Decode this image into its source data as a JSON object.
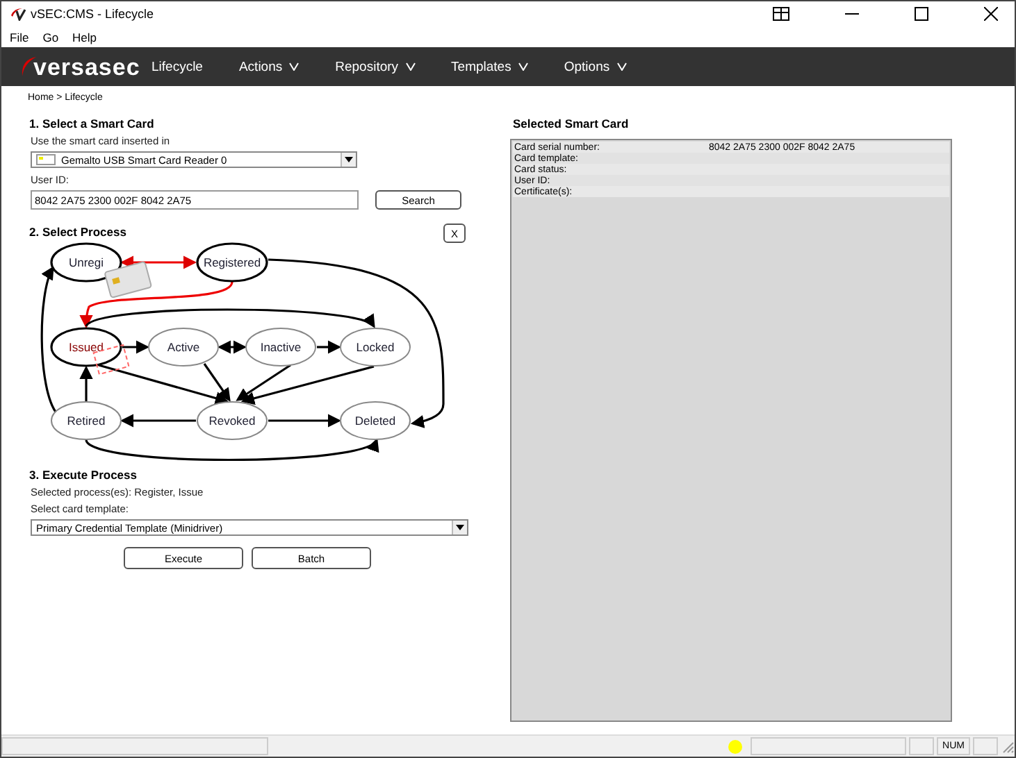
{
  "window": {
    "title": "vSEC:CMS -  Lifecycle"
  },
  "menu": [
    "File",
    "Go",
    "Help"
  ],
  "nav": {
    "logo": "versasec",
    "items": [
      {
        "label": "Lifecycle",
        "has_menu": false
      },
      {
        "label": "Actions",
        "has_menu": true
      },
      {
        "label": "Repository",
        "has_menu": true
      },
      {
        "label": "Templates",
        "has_menu": true
      },
      {
        "label": "Options",
        "has_menu": true
      }
    ]
  },
  "breadcrumb": "Home > Lifecycle",
  "select_card": {
    "heading": "1. Select a Smart Card",
    "reader_label": "Use the smart card inserted in",
    "reader": "Gemalto USB Smart Card Reader 0",
    "user_id_label": "User ID:",
    "user_id": "8042 2A75 2300 002F 8042 2A75",
    "search_button": "Search"
  },
  "process": {
    "heading": "2. Select Process",
    "clear_button": "X",
    "nodes": [
      {
        "label": "Unregi",
        "selected": true
      },
      {
        "label": "Registered",
        "selected": true
      },
      {
        "label": "Issued",
        "selected": true
      },
      {
        "label": "Active",
        "selected": false
      },
      {
        "label": "Inactive",
        "selected": false
      },
      {
        "label": "Locked",
        "selected": false
      },
      {
        "label": "Retired",
        "selected": false
      },
      {
        "label": "Revoked",
        "selected": false
      },
      {
        "label": "Deleted",
        "selected": false
      }
    ]
  },
  "execute": {
    "heading": "3. Execute Process",
    "selected_text": "Selected process(es): Register, Issue",
    "template_label": "Select card template:",
    "template": "Primary Credential Template (Minidriver)",
    "buttons": [
      "Execute",
      "Batch"
    ]
  },
  "selected_card": {
    "heading": "Selected Smart Card",
    "rows": [
      {
        "label": "Card serial number:",
        "value": "8042 2A75 2300 002F 8042 2A75"
      },
      {
        "label": "Card template:",
        "value": ""
      },
      {
        "label": "Card status:",
        "value": ""
      },
      {
        "label": "User ID:",
        "value": ""
      },
      {
        "label": "Certificate(s):",
        "value": ""
      }
    ]
  },
  "status_bar": {
    "indicator": "NUM"
  }
}
